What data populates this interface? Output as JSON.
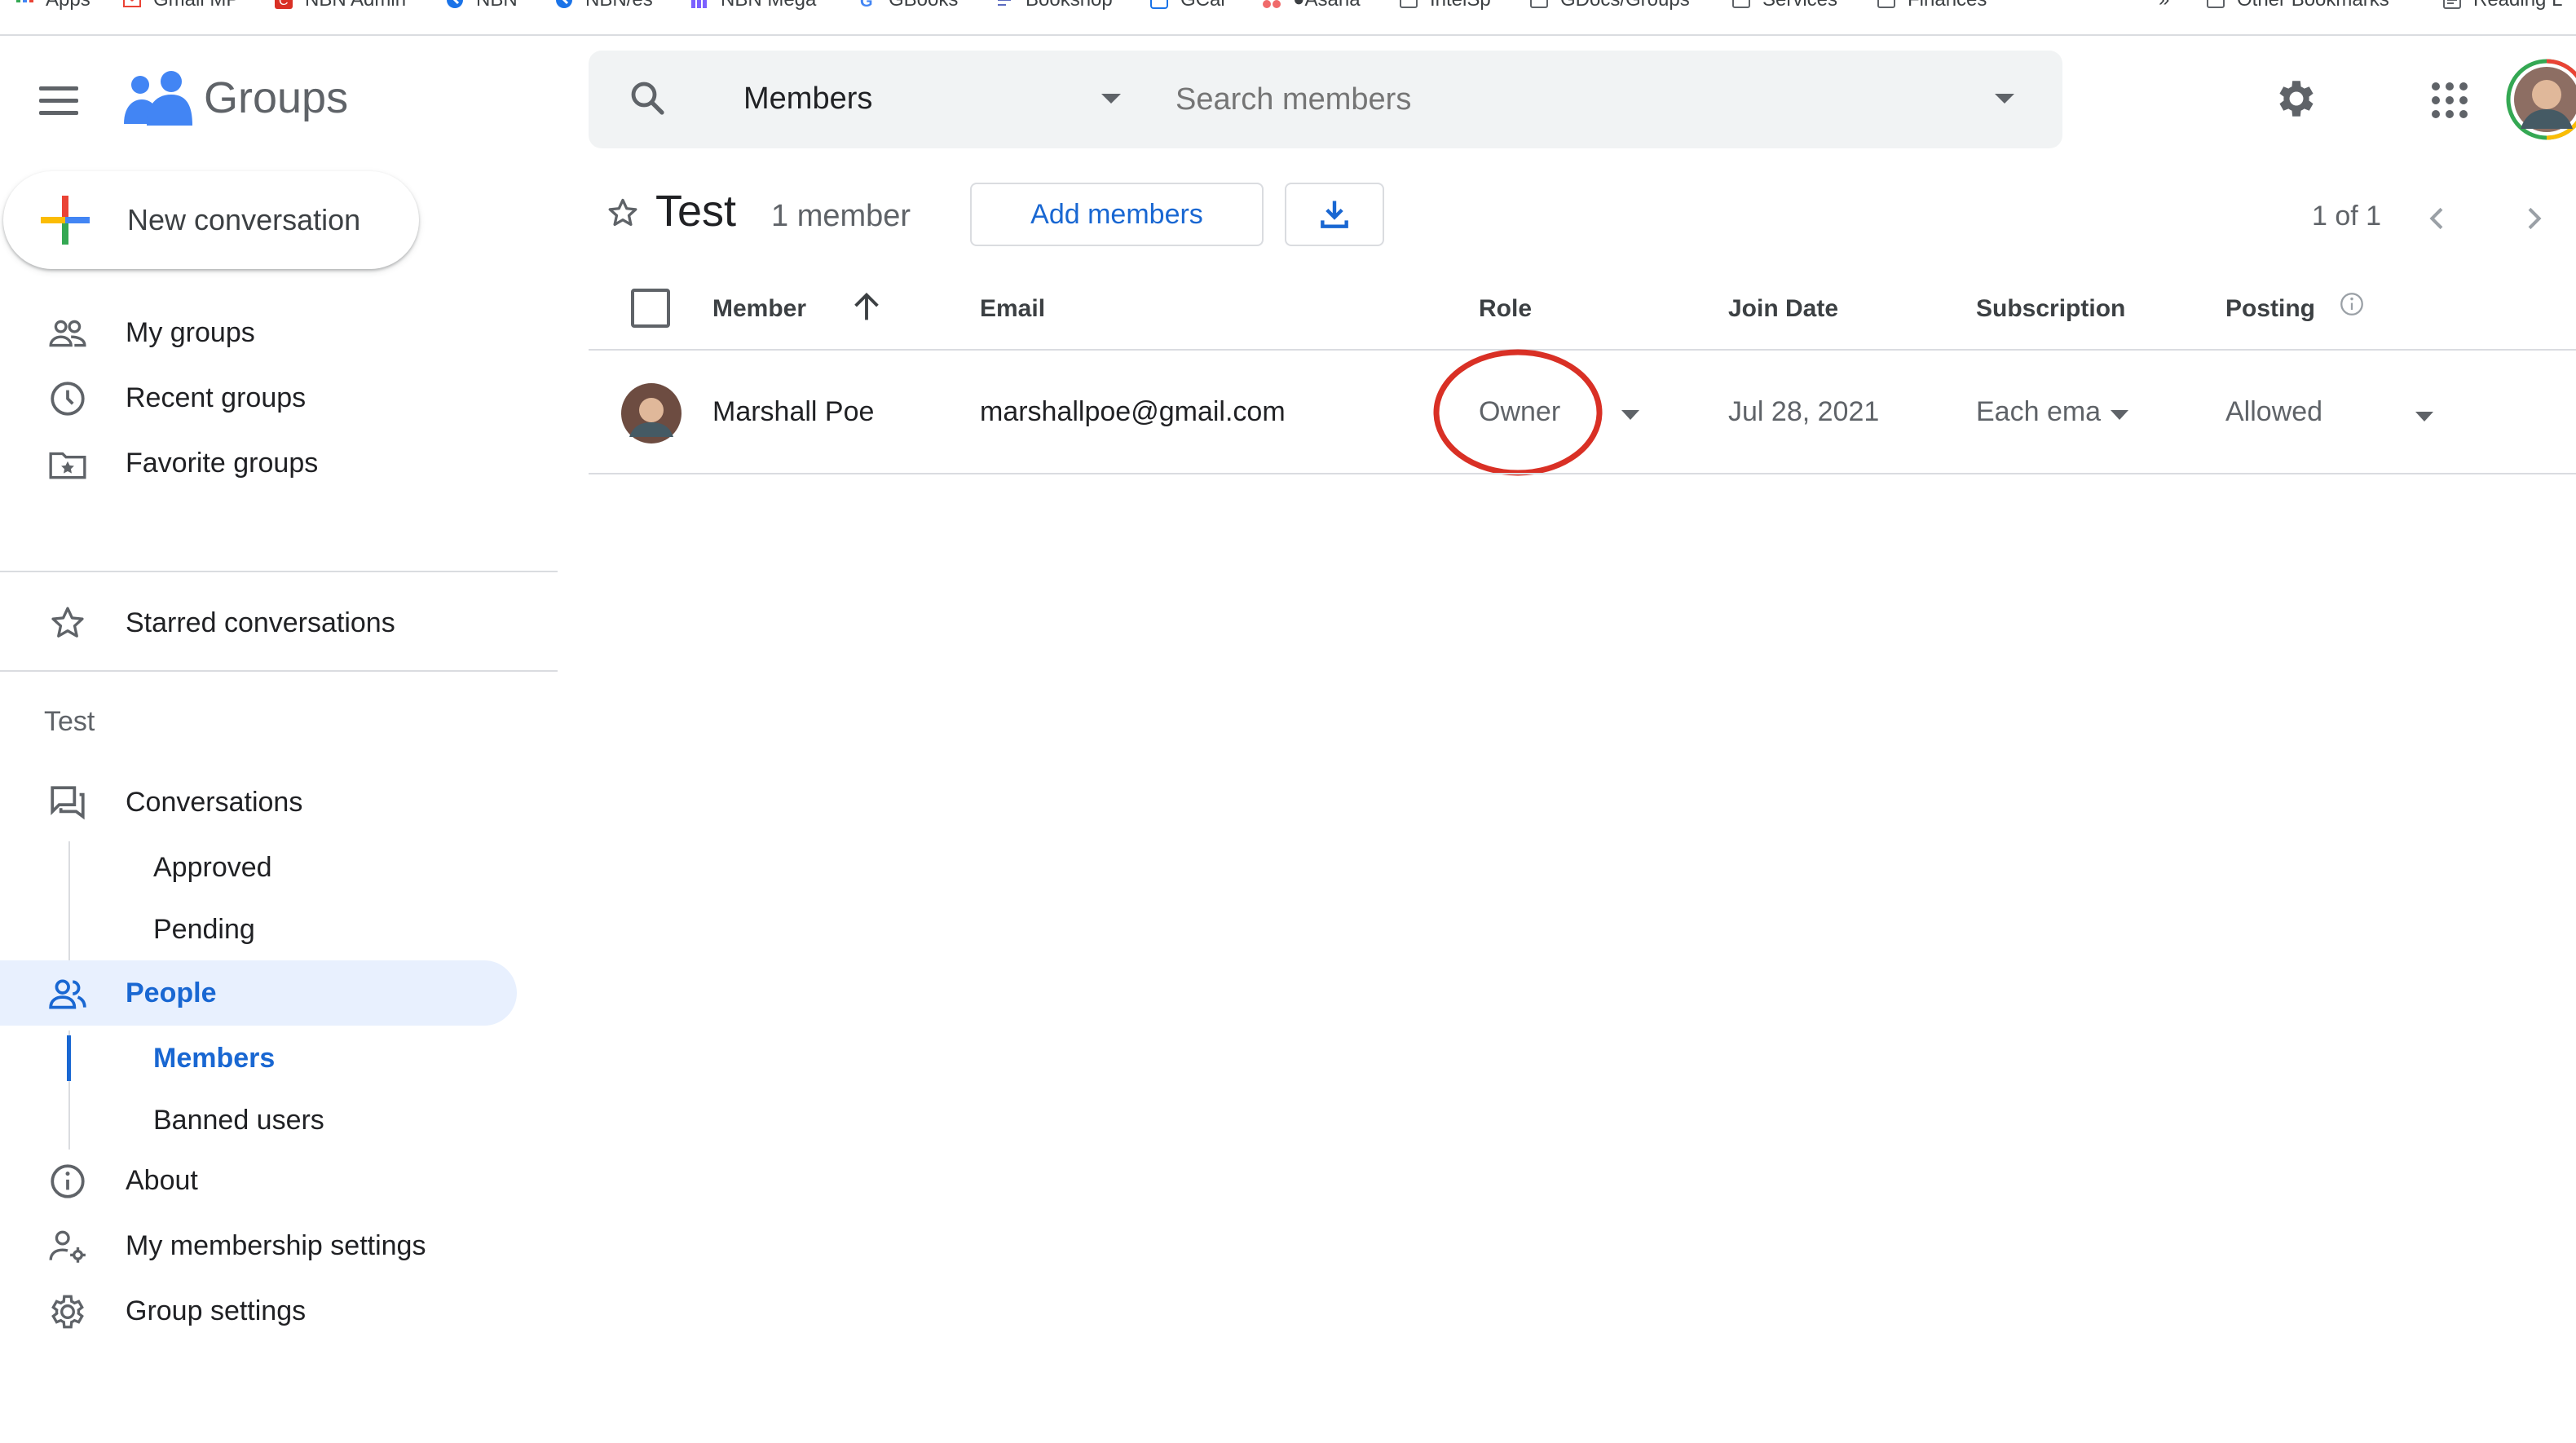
{
  "bookmarks": [
    {
      "label": "Apps",
      "icon": "apps-grid-icon",
      "color": "#4285f4"
    },
    {
      "label": "Gmail MP",
      "icon": "gmail-icon",
      "color": "#ea4335"
    },
    {
      "label": "NBN Admin",
      "icon": "nbn-admin-icon",
      "color": "#d93025"
    },
    {
      "label": "NBN",
      "icon": "nbn-icon",
      "color": "#1a73e8"
    },
    {
      "label": "NBN/es",
      "icon": "nbn-icon",
      "color": "#1a73e8"
    },
    {
      "label": "NBN Mega",
      "icon": "bar-chart-icon",
      "color": "#7b61ff"
    },
    {
      "label": "GBooks",
      "icon": "google-icon",
      "color": "#4285f4"
    },
    {
      "label": "Bookshop",
      "icon": "bookshop-icon",
      "color": "#5c6bc0"
    },
    {
      "label": "GCal",
      "icon": "calendar-icon",
      "color": "#1a73e8"
    },
    {
      "label": "●Asana",
      "icon": "asana-icon",
      "color": "#f06a6a"
    },
    {
      "label": "IntelSp",
      "icon": "folder-icon",
      "color": "#5f6368"
    },
    {
      "label": "GDocs/Groups",
      "icon": "folder-icon",
      "color": "#5f6368"
    },
    {
      "label": "Services",
      "icon": "folder-icon",
      "color": "#5f6368"
    },
    {
      "label": "Finances",
      "icon": "folder-icon",
      "color": "#5f6368"
    }
  ],
  "bookmarks_overflow": "»",
  "bookmarks_right": [
    {
      "label": "Other Bookmarks",
      "icon": "folder-icon"
    },
    {
      "label": "Reading L",
      "icon": "reading-list-icon"
    }
  ],
  "app": {
    "title": "Groups",
    "brand_color": "#4285f4"
  },
  "search": {
    "scope": "Members",
    "placeholder": "Search members"
  },
  "sidebar": {
    "new_conversation": "New conversation",
    "items": [
      {
        "label": "My groups",
        "icon": "people-icon"
      },
      {
        "label": "Recent groups",
        "icon": "clock-icon"
      },
      {
        "label": "Favorite groups",
        "icon": "folder-star-icon"
      }
    ],
    "starred": "Starred conversations",
    "group_name": "Test",
    "conversations": "Conversations",
    "approved": "Approved",
    "pending": "Pending",
    "people": "People",
    "members": "Members",
    "banned_users": "Banned users",
    "about": "About",
    "membership_settings": "My membership settings",
    "group_settings": "Group settings"
  },
  "group": {
    "name": "Test",
    "member_count": "1 member",
    "add_members": "Add members",
    "pagination": "1 of 1"
  },
  "table": {
    "headers": {
      "member": "Member",
      "email": "Email",
      "role": "Role",
      "join_date": "Join Date",
      "subscription": "Subscription",
      "posting": "Posting"
    },
    "rows": [
      {
        "name": "Marshall Poe",
        "email": "marshallpoe@gmail.com",
        "role": "Owner",
        "join_date": "Jul 28, 2021",
        "subscription": "Each ema",
        "posting": "Allowed"
      }
    ]
  },
  "colors": {
    "accent": "#1967d2",
    "active_bg": "#e8f0fe",
    "annotation": "#d93025"
  }
}
